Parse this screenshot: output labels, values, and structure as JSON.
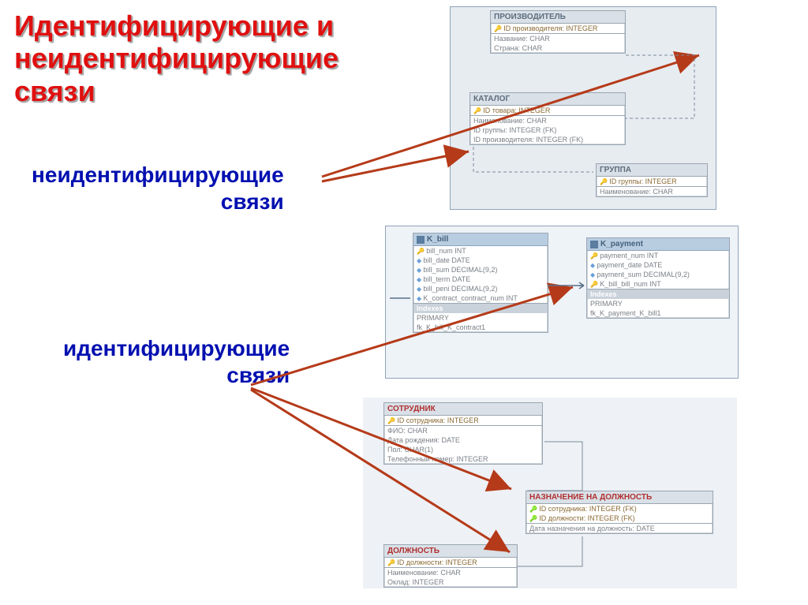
{
  "title_lines": "Идентифицирующие и\nнеидентифицирующие\nсвязи",
  "subtitle_nonident": "неидентифицирующие\n                             связи",
  "subtitle_ident": "идентифицирующие\n                        связи",
  "group1": {
    "producer": {
      "title": "ПРОИЗВОДИТЕЛЬ",
      "pk": "ID производителя: INTEGER",
      "r1": "Название: CHAR",
      "r2": "Страна: CHAR"
    },
    "catalog": {
      "title": "КАТАЛОГ",
      "pk": "ID товара: INTEGER",
      "r1": "Наименование: CHAR",
      "r2": "ID группы: INTEGER (FK)",
      "r3": "ID производителя: INTEGER (FK)"
    },
    "group": {
      "title": "ГРУППА",
      "pk": "ID группы: INTEGER",
      "r1": "Наименование: CHAR"
    }
  },
  "group2": {
    "kbill": {
      "title": "K_bill",
      "r1": "bill_num INT",
      "r2": "bill_date DATE",
      "r3": "bill_sum DECIMAL(9,2)",
      "r4": "bill_term DATE",
      "r5": "bill_peni DECIMAL(9,2)",
      "r6": "K_contract_contract_num INT",
      "idx": "Indexes",
      "i1": "PRIMARY",
      "i2": "fk_K_bill_K_contract1"
    },
    "kpayment": {
      "title": "K_payment",
      "r1": "payment_num INT",
      "r2": "payment_date DATE",
      "r3": "payment_sum DECIMAL(9,2)",
      "r4": "K_bill_bill_num INT",
      "idx": "Indexes",
      "i1": "PRIMARY",
      "i2": "fk_K_payment_K_bill1"
    }
  },
  "group3": {
    "employee": {
      "title": "СОТРУДНИК",
      "pk": "ID сотрудника: INTEGER",
      "r1": "ФИО: CHAR",
      "r2": "Дата рождения: DATE",
      "r3": "Пол: CHAR(1)",
      "r4": "Телефонный номер: INTEGER"
    },
    "assign": {
      "title": "НАЗНАЧЕНИЕ НА ДОЛЖНОСТЬ",
      "pk1": "ID сотрудника: INTEGER (FK)",
      "pk2": "ID должности: INTEGER (FK)",
      "r1": "Дата назначения на должность: DATE"
    },
    "position": {
      "title": "ДОЛЖНОСТЬ",
      "pk": "ID должности: INTEGER",
      "r1": "Наименование: CHAR",
      "r2": "Оклад: INTEGER"
    }
  }
}
